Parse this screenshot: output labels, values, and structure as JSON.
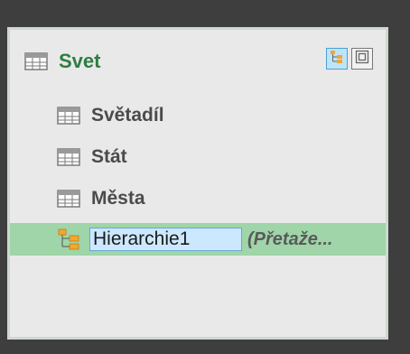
{
  "table": {
    "title": "Svet",
    "icon": "table-icon"
  },
  "header_tools": [
    {
      "name": "hierarchy-view-icon",
      "active": true
    },
    {
      "name": "diagram-view-icon",
      "active": false
    }
  ],
  "columns": [
    {
      "label": "Světadíl",
      "icon": "table-icon"
    },
    {
      "label": "Stát",
      "icon": "table-icon"
    },
    {
      "label": "Města",
      "icon": "table-icon"
    }
  ],
  "hierarchy": {
    "name_value": "Hierarchie1",
    "status": "(Přetaže...",
    "icon": "hierarchy-icon"
  },
  "colors": {
    "accent": "#2f7d43",
    "selection": "#9fd5a8",
    "rename_bg": "#cce8ff"
  }
}
